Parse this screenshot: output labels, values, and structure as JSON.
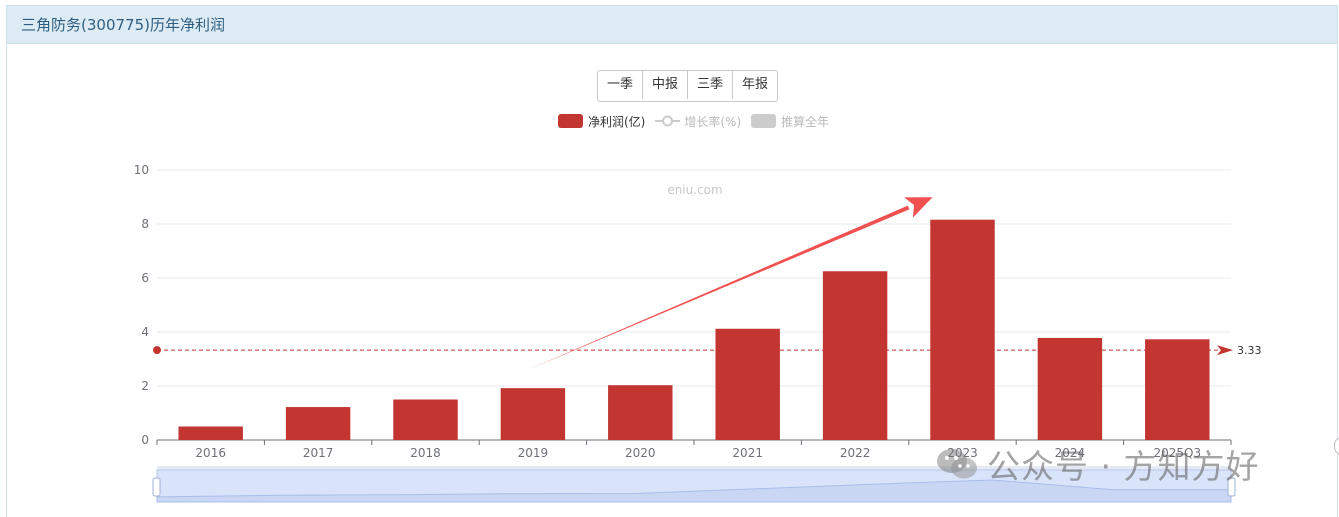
{
  "header": {
    "title": "三角防务(300775)历年净利润"
  },
  "period_tabs": [
    "一季",
    "中报",
    "三季",
    "年报"
  ],
  "legend": {
    "items": [
      {
        "label": "净利润(亿)",
        "active": true,
        "color": "#c23531"
      },
      {
        "label": "增长率(%)",
        "active": false,
        "color": "#cccccc"
      },
      {
        "label": "推算全年",
        "active": false,
        "color": "#cccccc"
      }
    ]
  },
  "watermark_site": "eniu.com",
  "watermark_wechat": "公众号 · 方知方好",
  "chart_data": {
    "type": "bar",
    "categories": [
      "2016",
      "2017",
      "2018",
      "2019",
      "2020",
      "2021",
      "2022",
      "2023",
      "2024",
      "2025Q3"
    ],
    "series": [
      {
        "name": "净利润(亿)",
        "values": [
          0.5,
          1.22,
          1.5,
          1.92,
          2.03,
          4.12,
          6.25,
          8.16,
          3.78,
          3.73
        ],
        "color": "#c23531"
      }
    ],
    "ylim": [
      0,
      10
    ],
    "yticks": [
      0,
      2,
      4,
      6,
      8,
      10
    ],
    "average_line": {
      "value": 3.33,
      "label": "3.33",
      "color": "#c23531"
    },
    "annotation_arrow": {
      "from": [
        "2019",
        2.6
      ],
      "to": [
        "2023",
        9.1
      ],
      "color": "#f0504f"
    },
    "grid": true,
    "legend_position": "top-center",
    "colors": {
      "axis": "#6e7079",
      "grid": "#e6e9f0",
      "datazoom_fill": "#d9e4fb",
      "datazoom_border": "#b7c8ec"
    }
  }
}
